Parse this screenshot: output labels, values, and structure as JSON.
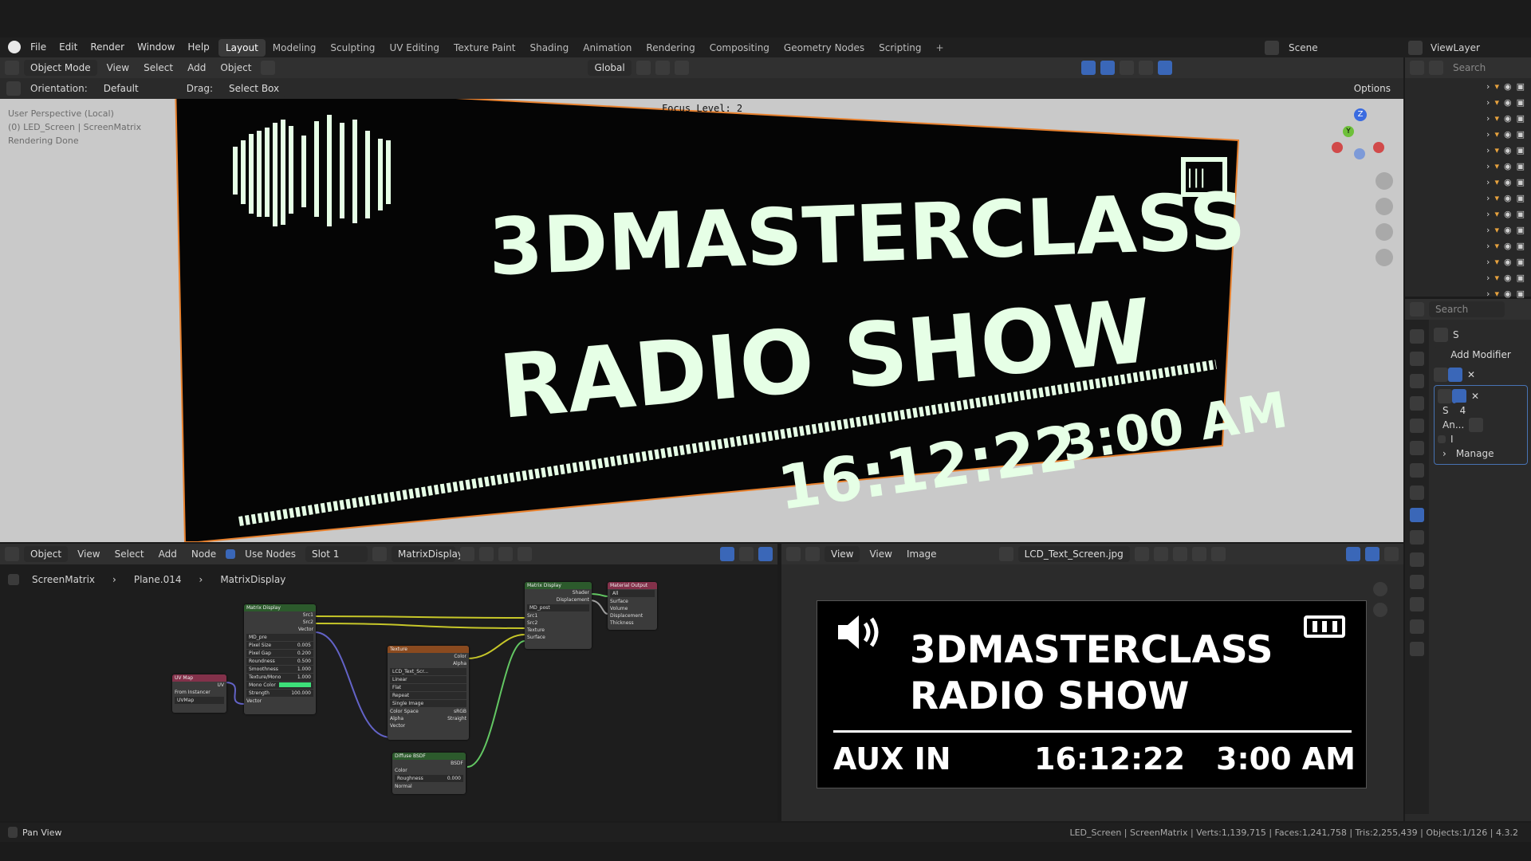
{
  "topbar": {
    "menu": [
      "File",
      "Edit",
      "Render",
      "Window",
      "Help"
    ],
    "workspaces": [
      "Layout",
      "Modeling",
      "Sculpting",
      "UV Editing",
      "Texture Paint",
      "Shading",
      "Animation",
      "Rendering",
      "Compositing",
      "Geometry Nodes",
      "Scripting"
    ],
    "active_workspace": "Layout",
    "scene": "Scene",
    "view_layer": "ViewLayer"
  },
  "viewport": {
    "mode": "Object Mode",
    "menus": [
      "View",
      "Select",
      "Add",
      "Object"
    ],
    "transform_orientation": "Global",
    "orientation_label": "Orientation:",
    "orientation_value": "Default",
    "drag_label": "Drag:",
    "drag_value": "Select Box",
    "options": "Options",
    "info_line1": "User Perspective (Local)",
    "info_line2": "(0) LED_Screen | ScreenMatrix",
    "info_line3": "Rendering Done",
    "focus_level": "Focus Level: 2",
    "screen_title1": "3DMASTERCLASS",
    "screen_title2": "RADIO SHOW",
    "screen_time": "16:12:22",
    "screen_clock": "3:00 AM",
    "gizmo_z": "Z",
    "gizmo_y": "Y"
  },
  "node_editor": {
    "object": "Object",
    "menus": [
      "View",
      "Select",
      "Add",
      "Node"
    ],
    "use_nodes": "Use Nodes",
    "slot": "Slot 1",
    "material": "MatrixDisplay",
    "breadcrumb": [
      "ScreenMatrix",
      "Plane.014",
      "MatrixDisplay"
    ],
    "nodes": {
      "uvmap": {
        "title": "UV Map",
        "out": "UV",
        "from_instancer": "From Instancer",
        "map": "UVMap"
      },
      "matrix": {
        "title": "Matrix Display",
        "out1": "Src1",
        "out2": "Src2",
        "out3": "Vector",
        "dropdown": "MD_pre",
        "fields": [
          "Pixel Size",
          "Pixel Gap",
          "Roundness",
          "Smoothness",
          "Texture/Mono",
          "Mono Color",
          "Strength"
        ],
        "values": [
          "0.005",
          "0.200",
          "0.500",
          "1.000",
          "1.000",
          "",
          "100.000"
        ],
        "vector": "Vector"
      },
      "texture": {
        "title": "Texture",
        "out1": "Color",
        "out2": "Alpha",
        "image": "LCD_Text_Scr...",
        "opts": [
          "Linear",
          "Flat",
          "Repeat",
          "Single Image"
        ],
        "color_space_label": "Color Space",
        "color_space": "sRGB",
        "alpha_label": "Alpha",
        "alpha": "Straight",
        "vector": "Vector"
      },
      "group": {
        "title": "Matrix Display",
        "out1": "Shader",
        "out2": "Displacement",
        "dropdown": "MD_post",
        "in": [
          "Src1",
          "Src2",
          "Texture",
          "Surface"
        ]
      },
      "output": {
        "title": "Material Output",
        "target": "All",
        "in": [
          "Surface",
          "Volume",
          "Displacement",
          "Thickness"
        ]
      },
      "diffuse": {
        "title": "Diffuse BSDF",
        "out": "BSDF",
        "in": [
          "Color",
          "Roughness",
          "Normal"
        ],
        "roughness": "0.000"
      }
    }
  },
  "image_editor": {
    "menus": [
      "View",
      "View",
      "Image"
    ],
    "image_name": "LCD_Text_Screen.jpg",
    "line1": "3DMASTERCLASS",
    "line2": "RADIO SHOW",
    "aux": "AUX IN",
    "time": "16:12:22",
    "clock": "3:00 AM"
  },
  "properties": {
    "search_placeholder": "Search",
    "add_modifier": "Add Modifier",
    "mod_s": "S",
    "mod_num": "4",
    "mod_an": "An...",
    "mod_i": "I",
    "manage": "Manage"
  },
  "statusbar": {
    "left": "Pan View",
    "right": "LED_Screen | ScreenMatrix | Verts:1,139,715 | Faces:1,241,758 | Tris:2,255,439 | Objects:1/126 | 4.3.2"
  },
  "colors": {
    "accent": "#4772b3",
    "lcd_green": "#d8ffd8",
    "selection_outline": "#e8812e"
  }
}
